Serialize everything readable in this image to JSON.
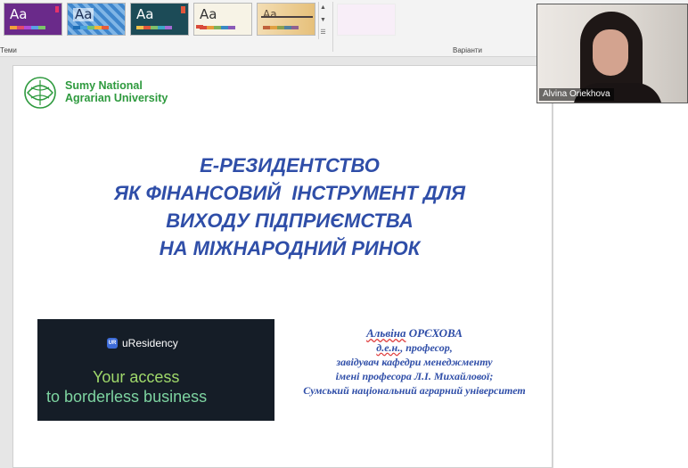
{
  "ribbon": {
    "themes_label": "Теми",
    "variants_label": "Варіанти",
    "theme_glyph": "Aa",
    "theme_colors": {
      "t1": "#6a2a8a",
      "t2": "#2f72b8",
      "t3": "#1c4b57",
      "t4": "#f7f3e6",
      "t5": "#f0d7a6"
    }
  },
  "slide": {
    "logo": {
      "line1": "Sumy National",
      "line2": "Agrarian University"
    },
    "title": {
      "line1": "Е-РЕЗИДЕНТСТВО",
      "line2": "ЯК ФІНАНСОВИЙ  ІНСТРУМЕНТ ДЛЯ",
      "line3": "ВИХОДУ ПІДПРИЄМСТВА",
      "line4": "НА МІЖНАРОДНИЙ РИНОК"
    },
    "banner": {
      "badge": "UR",
      "brand": "uResidency",
      "tagline1": "Your access",
      "tagline2": "to borderless business"
    },
    "author": {
      "first_name": "Альвіна",
      "last_name": "ОРЄХОВА",
      "degree": "д.е.н.",
      "degree_suffix": ", професор,",
      "line2": "завідувач кафедри менеджменту",
      "line3": "імені професора Л.І. Михайлової;",
      "line4": "Сумський національний аграрний університет"
    }
  },
  "video": {
    "participant_name": "Alvina Oriekhova"
  }
}
